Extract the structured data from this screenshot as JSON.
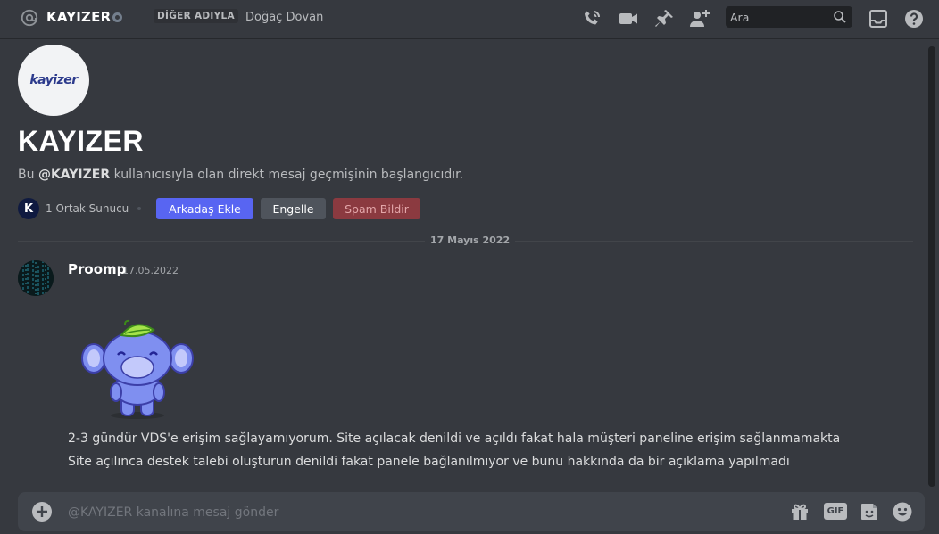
{
  "header": {
    "dm_name": "KAYIZER",
    "nick_tag": "DİĞER ADIYLA",
    "nick_name": "Doğaç Dovan",
    "search_placeholder": "Ara"
  },
  "intro": {
    "logo_text": "kayizer",
    "profile_name": "KAYIZER",
    "text_prefix": "Bu ",
    "text_user": "@KAYIZER",
    "text_suffix": " kullanıcısıyla olan direkt mesaj geçmişinin başlangıcıdır.",
    "mutual_servers": "1 Ortak Sunucu",
    "add_friend_label": "Arkadaş Ekle",
    "block_label": "Engelle",
    "report_spam_label": "Spam Bildir"
  },
  "date_divider": "17 Mayıs 2022",
  "message": {
    "author": "Proomp",
    "timestamp": "17.05.2022",
    "lines": [
      "2-3 gündür VDS'e erişim sağlayamıyorum. Site açılacak denildi ve açıldı fakat hala müşteri paneline erişim sağlanmamakta",
      "Site açılınca destek talebi oluşturun denildi fakat panele bağlanılmıyor ve bunu hakkında da bir açıklama yapılmadı"
    ]
  },
  "composer": {
    "placeholder": "@KAYIZER kanalına mesaj gönder",
    "gif_label": "GIF"
  },
  "colors": {
    "background": "#36393f",
    "blurple": "#5865f2",
    "danger": "#8b3a40",
    "composer": "#40444b"
  }
}
